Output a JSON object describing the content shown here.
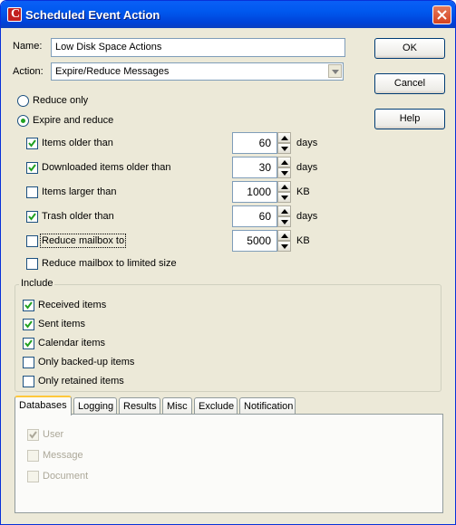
{
  "window": {
    "title": "Scheduled Event Action",
    "app_icon_letter": "C"
  },
  "form": {
    "name_label": "Name:",
    "name_value": "Low Disk Space Actions",
    "action_label": "Action:",
    "action_value": "Expire/Reduce Messages"
  },
  "buttons": {
    "ok": "OK",
    "cancel": "Cancel",
    "help": "Help"
  },
  "mode": {
    "reduce_only": "Reduce only",
    "expire_and_reduce": "Expire and reduce",
    "selected": "expire_and_reduce"
  },
  "criteria": [
    {
      "label": "Items older than",
      "checked": true,
      "value": "60",
      "unit": "days"
    },
    {
      "label": "Downloaded items older than",
      "checked": true,
      "value": "30",
      "unit": "days"
    },
    {
      "label": "Items larger than",
      "checked": false,
      "value": "1000",
      "unit": "KB"
    },
    {
      "label": "Trash older than",
      "checked": true,
      "value": "60",
      "unit": "days"
    },
    {
      "label": "Reduce mailbox to",
      "checked": false,
      "value": "5000",
      "unit": "KB"
    },
    {
      "label": "Reduce mailbox to limited size",
      "checked": false
    }
  ],
  "include": {
    "legend": "Include",
    "items": [
      {
        "label": "Received items",
        "checked": true
      },
      {
        "label": "Sent items",
        "checked": true
      },
      {
        "label": "Calendar items",
        "checked": true
      },
      {
        "label": "Only backed-up items",
        "checked": false
      },
      {
        "label": "Only retained items",
        "checked": false
      }
    ]
  },
  "tabs": {
    "items": [
      "Databases",
      "Logging",
      "Results",
      "Misc",
      "Exclude",
      "Notification"
    ],
    "active": "Databases"
  },
  "databases": [
    {
      "label": "User",
      "checked": true
    },
    {
      "label": "Message",
      "checked": false
    },
    {
      "label": "Document",
      "checked": false
    }
  ],
  "colors": {
    "titlebar": "#0058ee",
    "dialog_bg": "#ece9d8",
    "check": "#21a121"
  }
}
